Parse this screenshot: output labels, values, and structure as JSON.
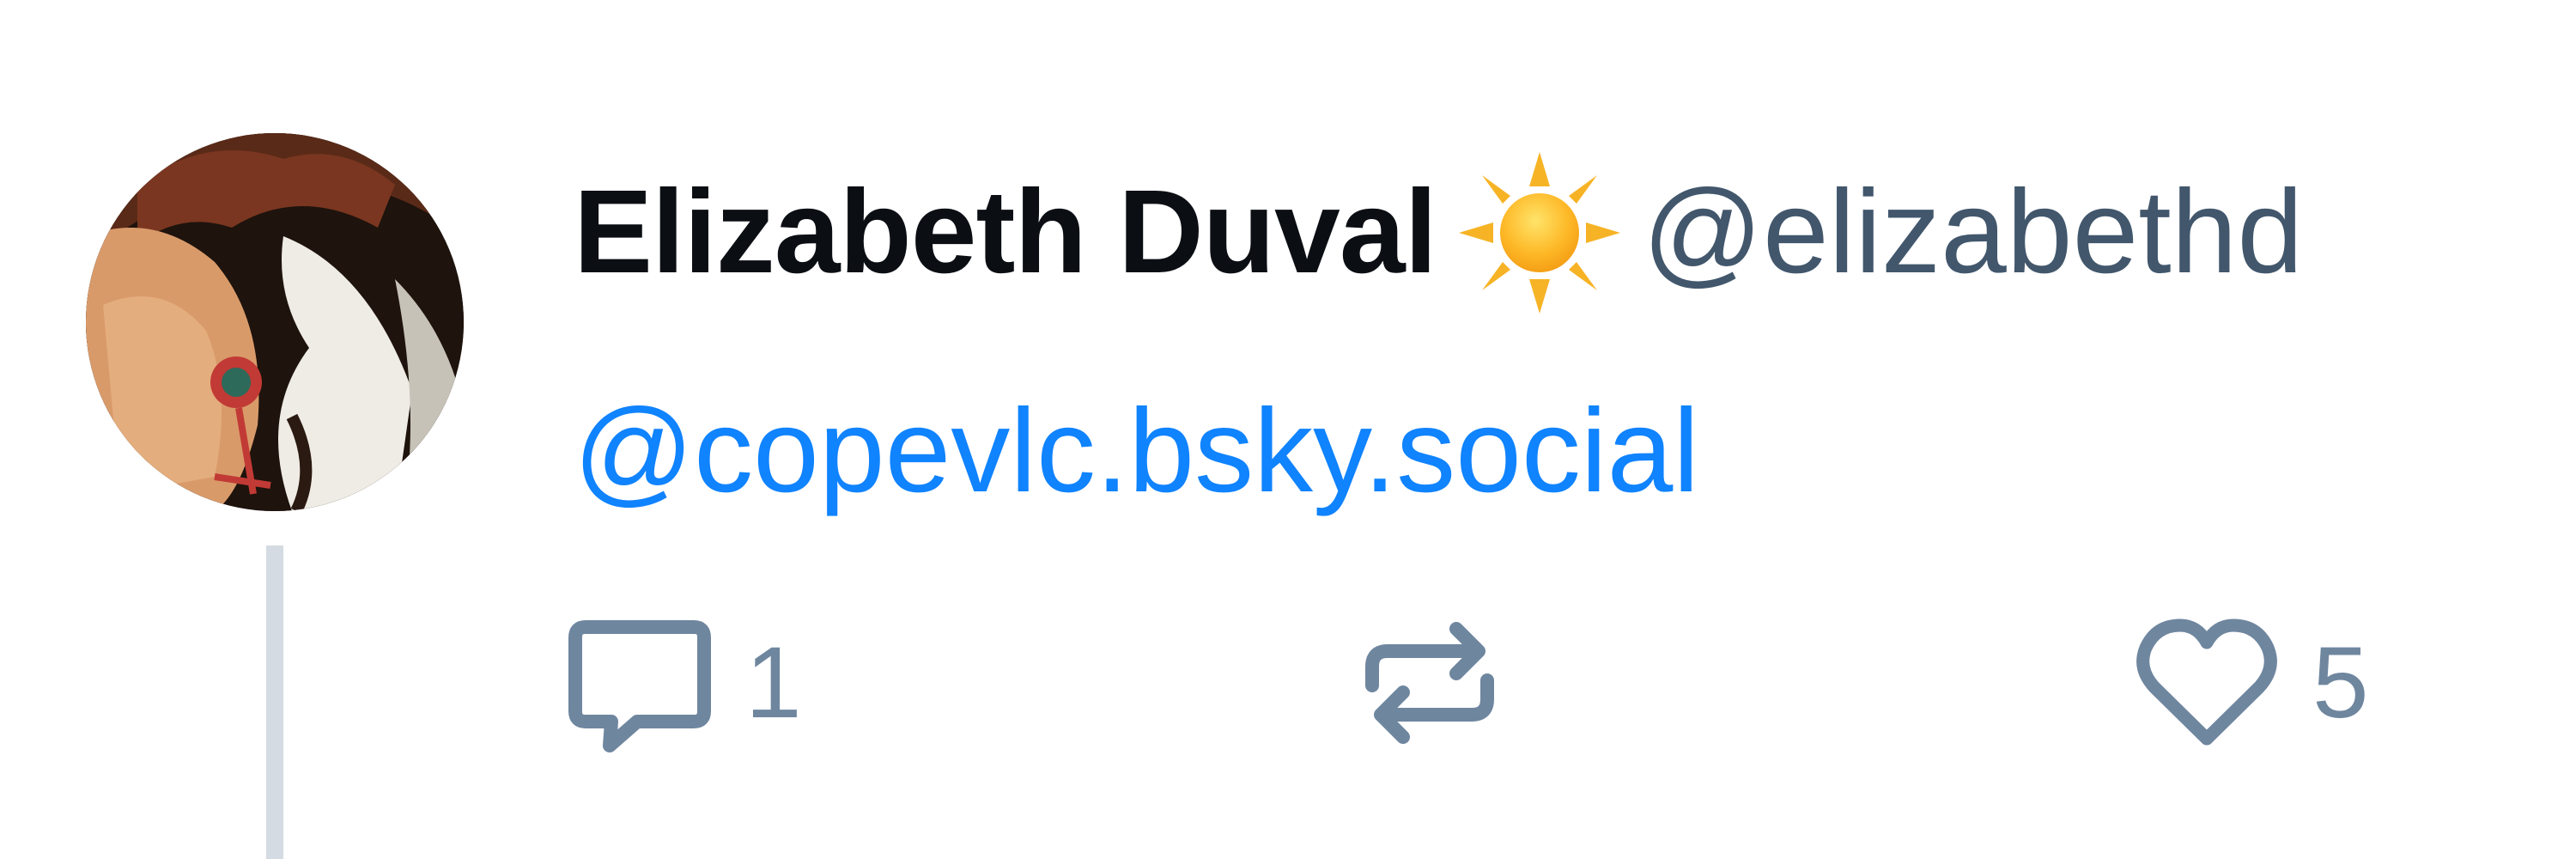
{
  "post": {
    "author": {
      "display_name": "Elizabeth Duval",
      "emoji_icon": "sun-icon",
      "handle": "@elizabethd"
    },
    "text": {
      "mention": "@copevlc.bsky.social"
    },
    "actions": {
      "reply_count": "1",
      "repost_count": "",
      "like_count": "5"
    }
  },
  "colors": {
    "name": "#0b0f14",
    "handle": "#42576c",
    "mention": "#1083fe",
    "action_icon": "#6f869f",
    "thread_line": "#d4dbe2"
  },
  "icons": [
    "sun-icon",
    "reply-icon",
    "repost-icon",
    "like-icon"
  ]
}
